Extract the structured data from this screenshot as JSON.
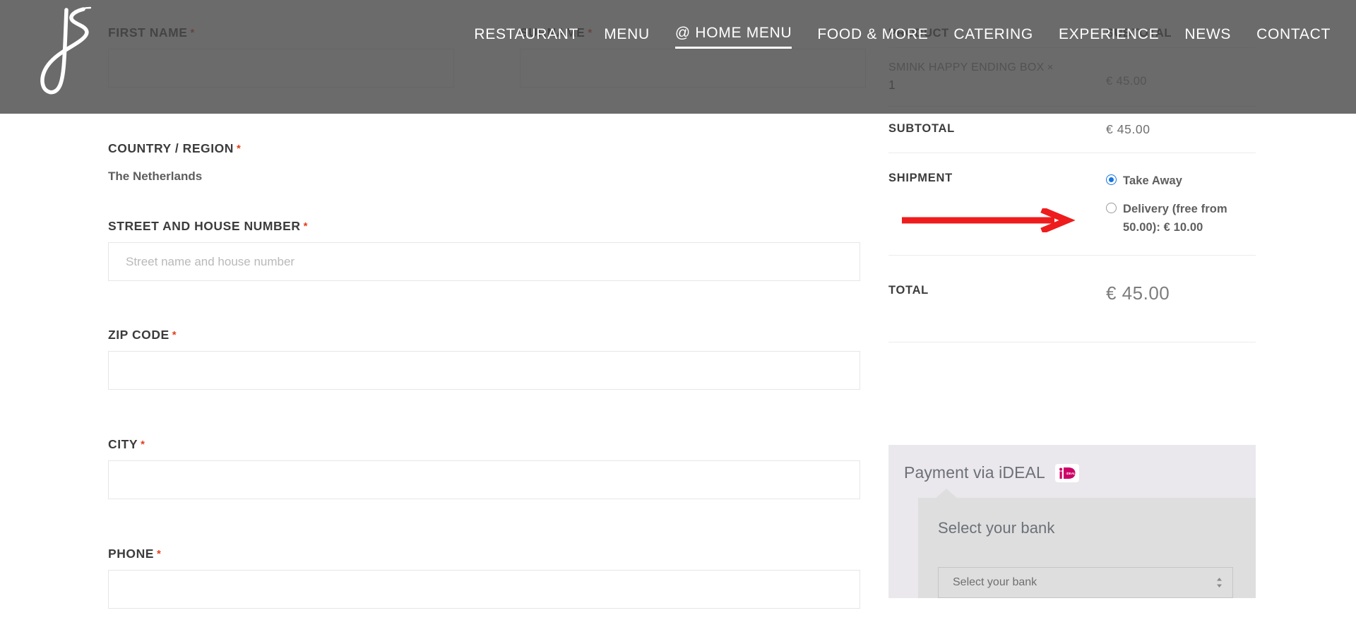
{
  "site": {
    "logo_alt": "js-script-logo"
  },
  "nav": {
    "items": [
      {
        "label": "RESTAURANT",
        "active": false
      },
      {
        "label": "MENU",
        "active": false
      },
      {
        "label": "@ HOME MENU",
        "active": true
      },
      {
        "label": "FOOD & MORE",
        "active": false
      },
      {
        "label": "CATERING",
        "active": false
      },
      {
        "label": "EXPERIENCE",
        "active": false
      },
      {
        "label": "NEWS",
        "active": false
      },
      {
        "label": "CONTACT",
        "active": false
      }
    ]
  },
  "form": {
    "first_name": {
      "label": "FIRST NAME",
      "required": "*",
      "value": "",
      "placeholder": ""
    },
    "surname": {
      "label": "SURNAME",
      "required": "*",
      "value": "",
      "placeholder": ""
    },
    "country": {
      "label": "COUNTRY / REGION",
      "required": "*",
      "value": "The Netherlands"
    },
    "street": {
      "label": "STREET AND HOUSE NUMBER",
      "required": "*",
      "value": "",
      "placeholder": "Street name and house number"
    },
    "zip": {
      "label": "ZIP CODE",
      "required": "*",
      "value": "",
      "placeholder": ""
    },
    "city": {
      "label": "CITY",
      "required": "*",
      "value": "",
      "placeholder": ""
    },
    "phone": {
      "label": "PHONE",
      "required": "*",
      "value": "",
      "placeholder": ""
    }
  },
  "order_summary": {
    "header_product": "PRODUCT",
    "header_subtotal": "SUBTOTAL",
    "line_item": {
      "name": "SMINK HAPPY ENDING BOX",
      "remove_glyph": "×",
      "quantity": "1",
      "amount": "€ 45.00"
    },
    "subtotal": {
      "label": "SUBTOTAL",
      "amount": "€  45.00"
    },
    "shipment": {
      "label": "SHIPMENT",
      "options": [
        {
          "label": "Take Away",
          "selected": true
        },
        {
          "label": "Delivery (free from 50.00): €  10.00",
          "selected": false
        }
      ]
    },
    "total": {
      "label": "TOTAL",
      "amount": "€ 45.00"
    }
  },
  "payment": {
    "title": "Payment via iDEAL",
    "logo_alt": "ideal-logo",
    "inner_title": "Select your bank",
    "bank_select": {
      "value": "Select your bank"
    }
  },
  "annotation": {
    "arrow_color": "#ee1c1c",
    "points_to": "delivery-shipment-option"
  }
}
